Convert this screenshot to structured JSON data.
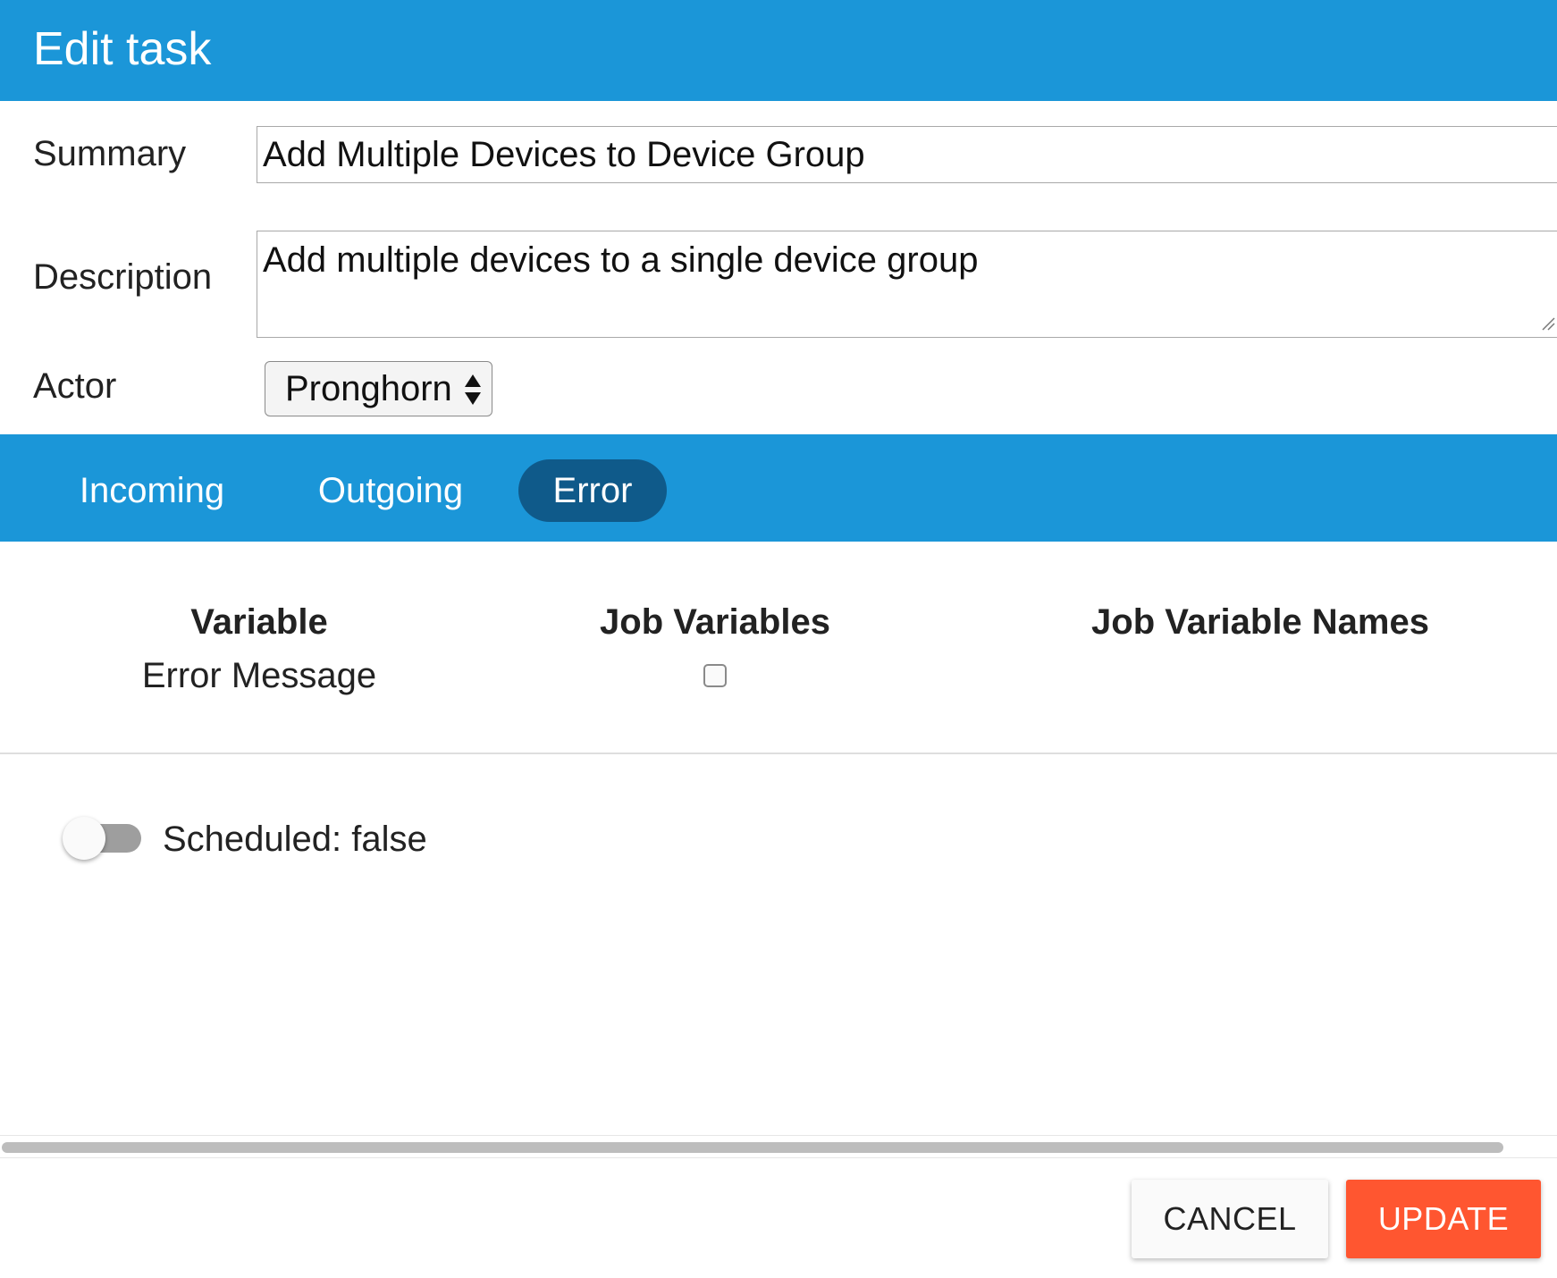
{
  "dialog": {
    "title": "Edit task"
  },
  "form": {
    "summary_label": "Summary",
    "summary_value": "Add Multiple Devices to Device Group",
    "description_label": "Description",
    "description_value": "Add multiple devices to a single device group",
    "actor_label": "Actor",
    "actor_value": "Pronghorn"
  },
  "tabs": [
    {
      "label": "Incoming",
      "active": false
    },
    {
      "label": "Outgoing",
      "active": false
    },
    {
      "label": "Error",
      "active": true
    }
  ],
  "table": {
    "columns": [
      "Variable",
      "Job Variables",
      "Job Variable Names"
    ],
    "rows": [
      {
        "variable": "Error Message",
        "job_variable_checked": false,
        "job_variable_name": ""
      }
    ]
  },
  "scheduled": {
    "label": "Scheduled: false",
    "on": false
  },
  "footer": {
    "cancel_label": "CANCEL",
    "update_label": "UPDATE"
  },
  "colors": {
    "header": "#1b96d8",
    "active_tab": "#0f5a8a",
    "update_button": "#ff5630"
  },
  "icons": {
    "actor_select": "updown-arrows-icon",
    "textarea_resize": "resize-grip-icon"
  }
}
